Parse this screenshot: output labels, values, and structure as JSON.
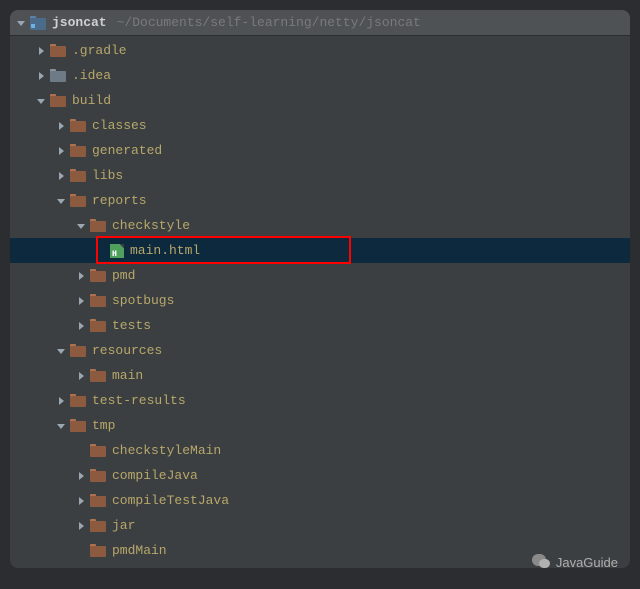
{
  "header": {
    "project_name": "jsoncat",
    "project_path": "~/Documents/self-learning/netty/jsoncat"
  },
  "tree": {
    "items": [
      {
        "level": 1,
        "arrow": "right",
        "icon": "folder-red",
        "label": ".gradle"
      },
      {
        "level": 1,
        "arrow": "right",
        "icon": "folder-grey",
        "label": ".idea"
      },
      {
        "level": 1,
        "arrow": "down",
        "icon": "folder-red",
        "label": "build"
      },
      {
        "level": 2,
        "arrow": "right",
        "icon": "folder-red",
        "label": "classes"
      },
      {
        "level": 2,
        "arrow": "right",
        "icon": "folder-red",
        "label": "generated"
      },
      {
        "level": 2,
        "arrow": "right",
        "icon": "folder-red",
        "label": "libs"
      },
      {
        "level": 2,
        "arrow": "down",
        "icon": "folder-red",
        "label": "reports"
      },
      {
        "level": 3,
        "arrow": "down",
        "icon": "folder-red",
        "label": "checkstyle"
      },
      {
        "level": 4,
        "arrow": "none",
        "icon": "file-html",
        "label": "main.html",
        "selected": true,
        "redbox": true
      },
      {
        "level": 3,
        "arrow": "right",
        "icon": "folder-red",
        "label": "pmd"
      },
      {
        "level": 3,
        "arrow": "right",
        "icon": "folder-red",
        "label": "spotbugs"
      },
      {
        "level": 3,
        "arrow": "right",
        "icon": "folder-red",
        "label": "tests"
      },
      {
        "level": 2,
        "arrow": "down",
        "icon": "folder-red",
        "label": "resources"
      },
      {
        "level": 3,
        "arrow": "right",
        "icon": "folder-red",
        "label": "main"
      },
      {
        "level": 2,
        "arrow": "right",
        "icon": "folder-red",
        "label": "test-results"
      },
      {
        "level": 2,
        "arrow": "down",
        "icon": "folder-red",
        "label": "tmp"
      },
      {
        "level": 3,
        "arrow": "none",
        "icon": "folder-red",
        "label": "checkstyleMain"
      },
      {
        "level": 3,
        "arrow": "right",
        "icon": "folder-red",
        "label": "compileJava"
      },
      {
        "level": 3,
        "arrow": "right",
        "icon": "folder-red",
        "label": "compileTestJava"
      },
      {
        "level": 3,
        "arrow": "right",
        "icon": "folder-red",
        "label": "jar"
      },
      {
        "level": 3,
        "arrow": "none",
        "icon": "folder-red",
        "label": "pmdMain"
      }
    ]
  },
  "watermark": {
    "text": "JavaGuide"
  }
}
